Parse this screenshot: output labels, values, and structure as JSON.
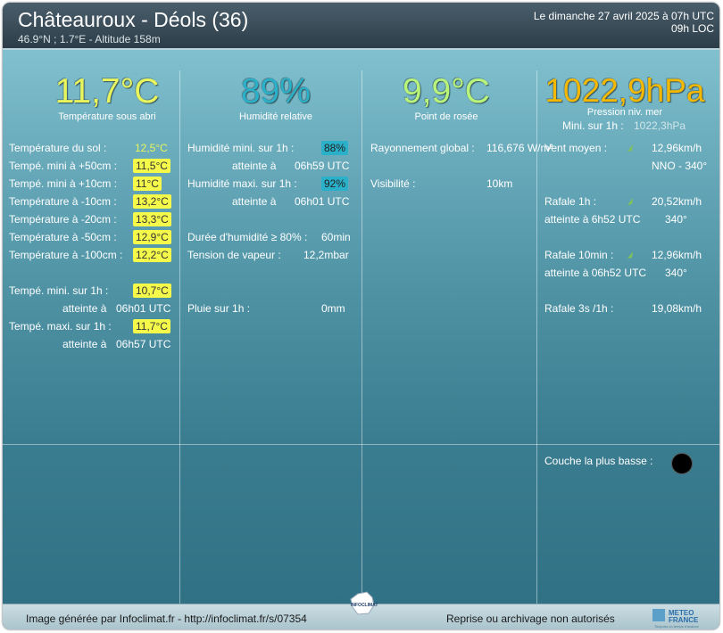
{
  "header": {
    "station": "Châteauroux - Déols (36)",
    "coords": "46.9°N ; 1.7°E - Altitude 158m",
    "date_line": "Le dimanche 27 avril 2025 à 07h UTC",
    "local_line": "09h LOC"
  },
  "summary": {
    "temperature": {
      "value": "11,7°C",
      "label": "Température sous abri"
    },
    "humidity": {
      "value": "89%",
      "label": "Humidité relative"
    },
    "dewpoint": {
      "value": "9,9°C",
      "label": "Point de rosée"
    },
    "pressure": {
      "value": "1022,9hPa",
      "label": "Pression niv. mer",
      "min_label": "Mini. sur 1h :",
      "min_value": "1022,3hPa"
    }
  },
  "col1": {
    "rows": [
      {
        "label": "Température du sol :",
        "value": "12,5°C"
      },
      {
        "label": "Tempé. mini à +50cm :",
        "value": "11,5°C"
      },
      {
        "label": "Tempé. mini à +10cm :",
        "value": "11°C"
      },
      {
        "label": "Température à -10cm :",
        "value": "13,2°C"
      },
      {
        "label": "Température à -20cm :",
        "value": "13,3°C"
      },
      {
        "label": "Température à -50cm :",
        "value": "12,9°C"
      },
      {
        "label": "Température à -100cm :",
        "value": "12,2°C"
      }
    ],
    "min_label": "Tempé. mini. sur 1h :",
    "min_value": "10,7°C",
    "min_at_label": "atteinte à",
    "min_at_value": "06h01 UTC",
    "max_label": "Tempé. maxi. sur 1h :",
    "max_value": "11,7°C",
    "max_at_label": "atteinte à",
    "max_at_value": "06h57 UTC"
  },
  "col2": {
    "hum_min_label": "Humidité mini. sur 1h :",
    "hum_min_value": "88%",
    "hum_min_at_label": "atteinte à",
    "hum_min_at_value": "06h59 UTC",
    "hum_max_label": "Humidité maxi. sur 1h :",
    "hum_max_value": "92%",
    "hum_max_at_label": "atteinte à",
    "hum_max_at_value": "06h01 UTC",
    "wet_label": "Durée d'humidité ≥ 80% :",
    "wet_value": "60min",
    "vapor_label": "Tension de vapeur :",
    "vapor_value": "12,2mbar",
    "rain_label": "Pluie sur 1h :",
    "rain_value": "0mm"
  },
  "col3": {
    "rad_label": "Rayonnement global :",
    "rad_value": "116,676 W/m²",
    "vis_label": "Visibilité :",
    "vis_value": "10km"
  },
  "col4": {
    "wind_label": "Vent moyen :",
    "wind_value": "12,96km/h",
    "wind_dir": "NNO - 340°",
    "gust1h_label": "Rafale 1h :",
    "gust1h_value": "20,52km/h",
    "gust1h_at": "atteinte à 6h52 UTC",
    "gust1h_dir": "340°",
    "gust10_label": "Rafale 10min :",
    "gust10_value": "12,96km/h",
    "gust10_at": "atteinte à 06h52 UTC",
    "gust10_dir": "340°",
    "gust3s_label": "Rafale 3s /1h :",
    "gust3s_value": "19,08km/h",
    "cloud_label": "Couche la plus basse :"
  },
  "footer": {
    "left": "Image générée par Infoclimat.fr - http://infoclimat.fr/s/07354",
    "right": "Reprise ou archivage non autorisés",
    "center_logo": "INFOCLIMAT",
    "brand_line1": "METEO",
    "brand_line2": "FRANCE",
    "brand_tag": "Toujours un temps d'avance"
  },
  "colors": {
    "temp": "#e8f55c",
    "humidity": "#2ab0c8",
    "dew": "#b8f37a",
    "pressure": "#f5b800"
  }
}
